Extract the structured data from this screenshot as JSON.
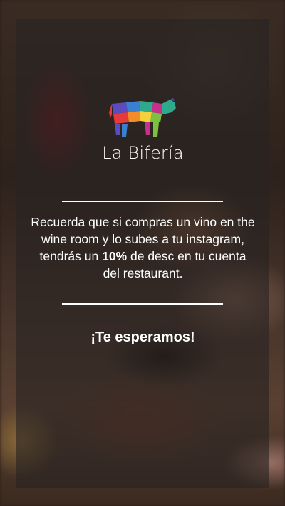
{
  "brand": {
    "name": "La Bifería",
    "logo_icon": "cow-cuts-icon"
  },
  "message": {
    "text_before": "Recuerda que si compras un vino en the wine room y lo subes a tu instagram, tendrás un ",
    "discount": "10%",
    "text_after": " de desc en tu cuenta del restaurant."
  },
  "cta": {
    "text": "¡Te esperamos!"
  },
  "colors": {
    "card_overlay": "#282422",
    "text": "#ffffff",
    "logo_segments": [
      "#c62f8e",
      "#e53a3a",
      "#f28c28",
      "#f3d03e",
      "#7fbf3f",
      "#2fa98c",
      "#3a7fd0",
      "#5b4bbf"
    ]
  }
}
